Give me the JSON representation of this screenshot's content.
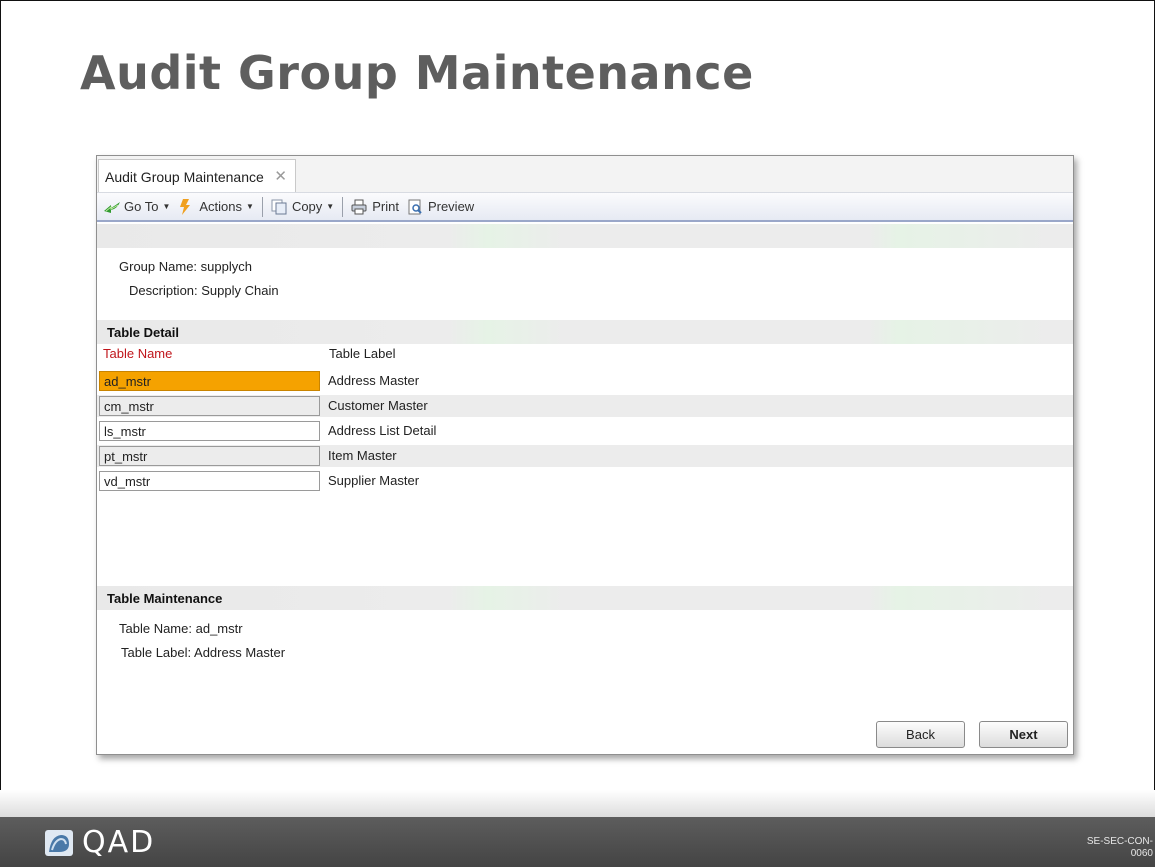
{
  "slide": {
    "title": "Audit Group Maintenance"
  },
  "window": {
    "tab_label": "Audit Group Maintenance",
    "toolbar": {
      "goto_label": "Go To",
      "actions_label": "Actions",
      "copy_label": "Copy",
      "print_label": "Print",
      "preview_label": "Preview"
    },
    "group": {
      "name_label": "Group Name:",
      "name_value": "supplych",
      "description_label": "Description:",
      "description_value": "Supply Chain"
    },
    "table_detail": {
      "section_title": "Table Detail",
      "col_table_name": "Table Name",
      "col_table_label": "Table Label",
      "rows": [
        {
          "name": "ad_mstr",
          "label": "Address Master"
        },
        {
          "name": "cm_mstr",
          "label": "Customer Master"
        },
        {
          "name": "ls_mstr",
          "label": "Address List Detail"
        },
        {
          "name": "pt_mstr",
          "label": "Item Master"
        },
        {
          "name": "vd_mstr",
          "label": "Supplier Master"
        }
      ]
    },
    "table_maintenance": {
      "section_title": "Table Maintenance",
      "table_name_label": "Table Name:",
      "table_name_value": "ad_mstr",
      "table_label_label": "Table Label:",
      "table_label_value": "Address Master"
    },
    "buttons": {
      "back": "Back",
      "next": "Next"
    }
  },
  "footer": {
    "logo_text": "QAD",
    "code_line1": "SE-SEC-CON-",
    "code_line2": "0060"
  },
  "colors": {
    "title": "#5e5e5e",
    "selected_row": "#f5a200",
    "column_header_red": "#c0161c",
    "footer_bar": "#4e4e4e"
  }
}
